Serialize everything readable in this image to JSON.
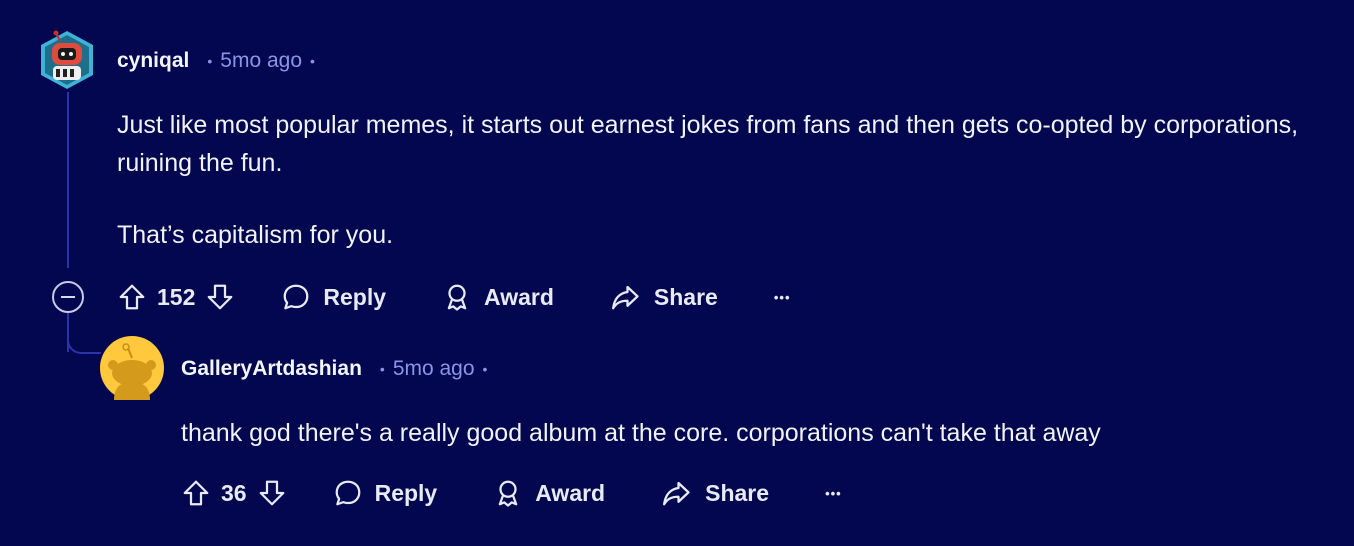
{
  "comments": [
    {
      "username": "cyniqal",
      "time": "5mo ago",
      "paragraphs": [
        "Just like most popular memes, it starts out earnest jokes from fans and then gets co-opted by corporations, ruining the fun.",
        "That’s capitalism for you."
      ],
      "votes": "152",
      "reply_label": "Reply",
      "award_label": "Award",
      "share_label": "Share",
      "more_label": "•••"
    },
    {
      "username": "GalleryArtdashian",
      "time": "5mo ago",
      "paragraphs": [
        "thank god there's a really good album at the core. corporations can't take that away"
      ],
      "votes": "36",
      "reply_label": "Reply",
      "award_label": "Award",
      "share_label": "Share",
      "more_label": "•••"
    }
  ],
  "separator": "•",
  "colors": {
    "background": "#03074f",
    "meta": "#8a94e8",
    "thread_line": "#2a34a8",
    "avatar_2": "#ffc83d"
  }
}
